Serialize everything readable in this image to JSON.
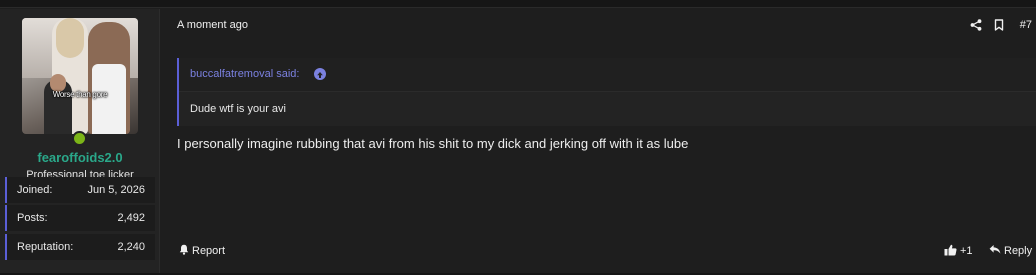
{
  "user": {
    "avatar_caption": "Worse than gore",
    "username": "fearoffoids2.0",
    "title": "Professional toe licker",
    "stats": [
      {
        "label": "Joined:",
        "value": "Jun 5, 2026"
      },
      {
        "label": "Posts:",
        "value": "2,492"
      },
      {
        "label": "Reputation:",
        "value": "2,240"
      }
    ]
  },
  "post": {
    "time": "A moment ago",
    "number": "#7",
    "quote": {
      "author": "buccalfatremoval said:",
      "text": "Dude wtf is your avi"
    },
    "message": "I personally imagine rubbing that avi from his shit to my dick and jerking off with it as lube"
  },
  "actions": {
    "report_label": "Report",
    "like_label": "+1",
    "reply_label": "Reply"
  },
  "icons": {
    "share": "share-icon",
    "bookmark": "bookmark-icon",
    "quote_jump": "arrow-up-circle-icon",
    "report": "bell-icon",
    "like": "thumbs-up-icon",
    "reply": "reply-arrow-icon"
  },
  "colors": {
    "accent": "#5b5fd6",
    "username": "#2aa88a",
    "online": "#7cb518",
    "quote_author": "#7b81e0"
  }
}
